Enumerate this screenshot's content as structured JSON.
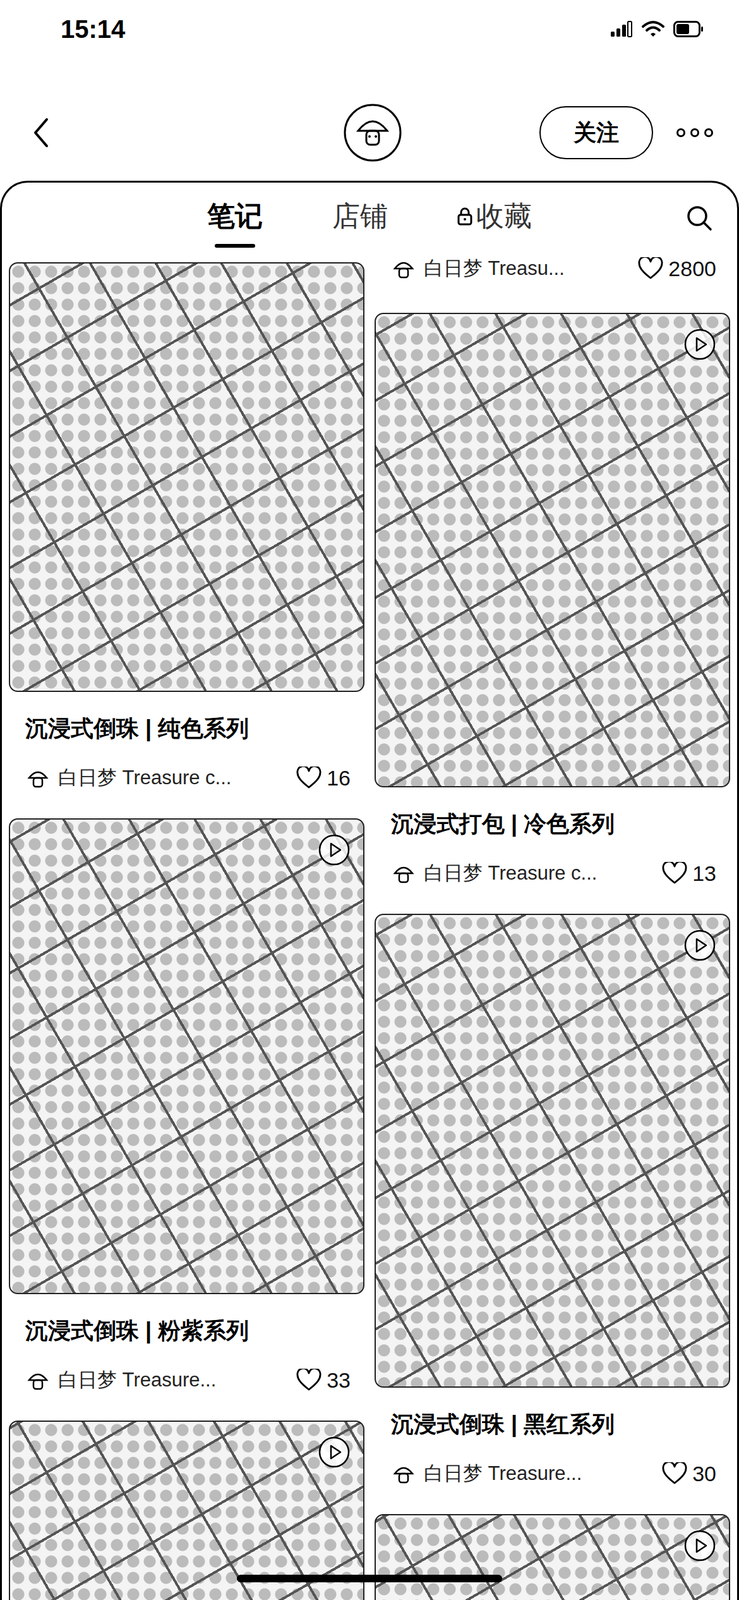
{
  "status_bar": {
    "time": "15:14",
    "battery_level": 0.6
  },
  "header": {
    "follow_button": "关注"
  },
  "tabs": [
    {
      "label": "笔记",
      "selected": true,
      "locked": false
    },
    {
      "label": "店铺",
      "selected": false,
      "locked": false
    },
    {
      "label": "收藏",
      "selected": false,
      "locked": true
    }
  ],
  "columns": [
    {
      "notes": [
        {
          "kind": "full",
          "title": "沉浸式倒珠 | 纯色系列",
          "author": "白日梦 Treasure c...",
          "likes": "16",
          "video": false
        },
        {
          "kind": "full",
          "title": "沉浸式倒珠 | 粉紫系列",
          "author": "白日梦 Treasure...",
          "likes": "33",
          "video": true
        },
        {
          "kind": "image",
          "video": true
        }
      ]
    },
    {
      "notes": [
        {
          "kind": "footer",
          "author": "白日梦 Treasu...",
          "likes": "2800"
        },
        {
          "kind": "full",
          "title": "沉浸式打包 | 冷色系列",
          "author": "白日梦 Treasure c...",
          "likes": "13",
          "video": true
        },
        {
          "kind": "full",
          "title": "沉浸式倒珠 | 黑红系列",
          "author": "白日梦 Treasure...",
          "likes": "30",
          "video": true
        },
        {
          "kind": "image",
          "video": true
        }
      ]
    }
  ]
}
